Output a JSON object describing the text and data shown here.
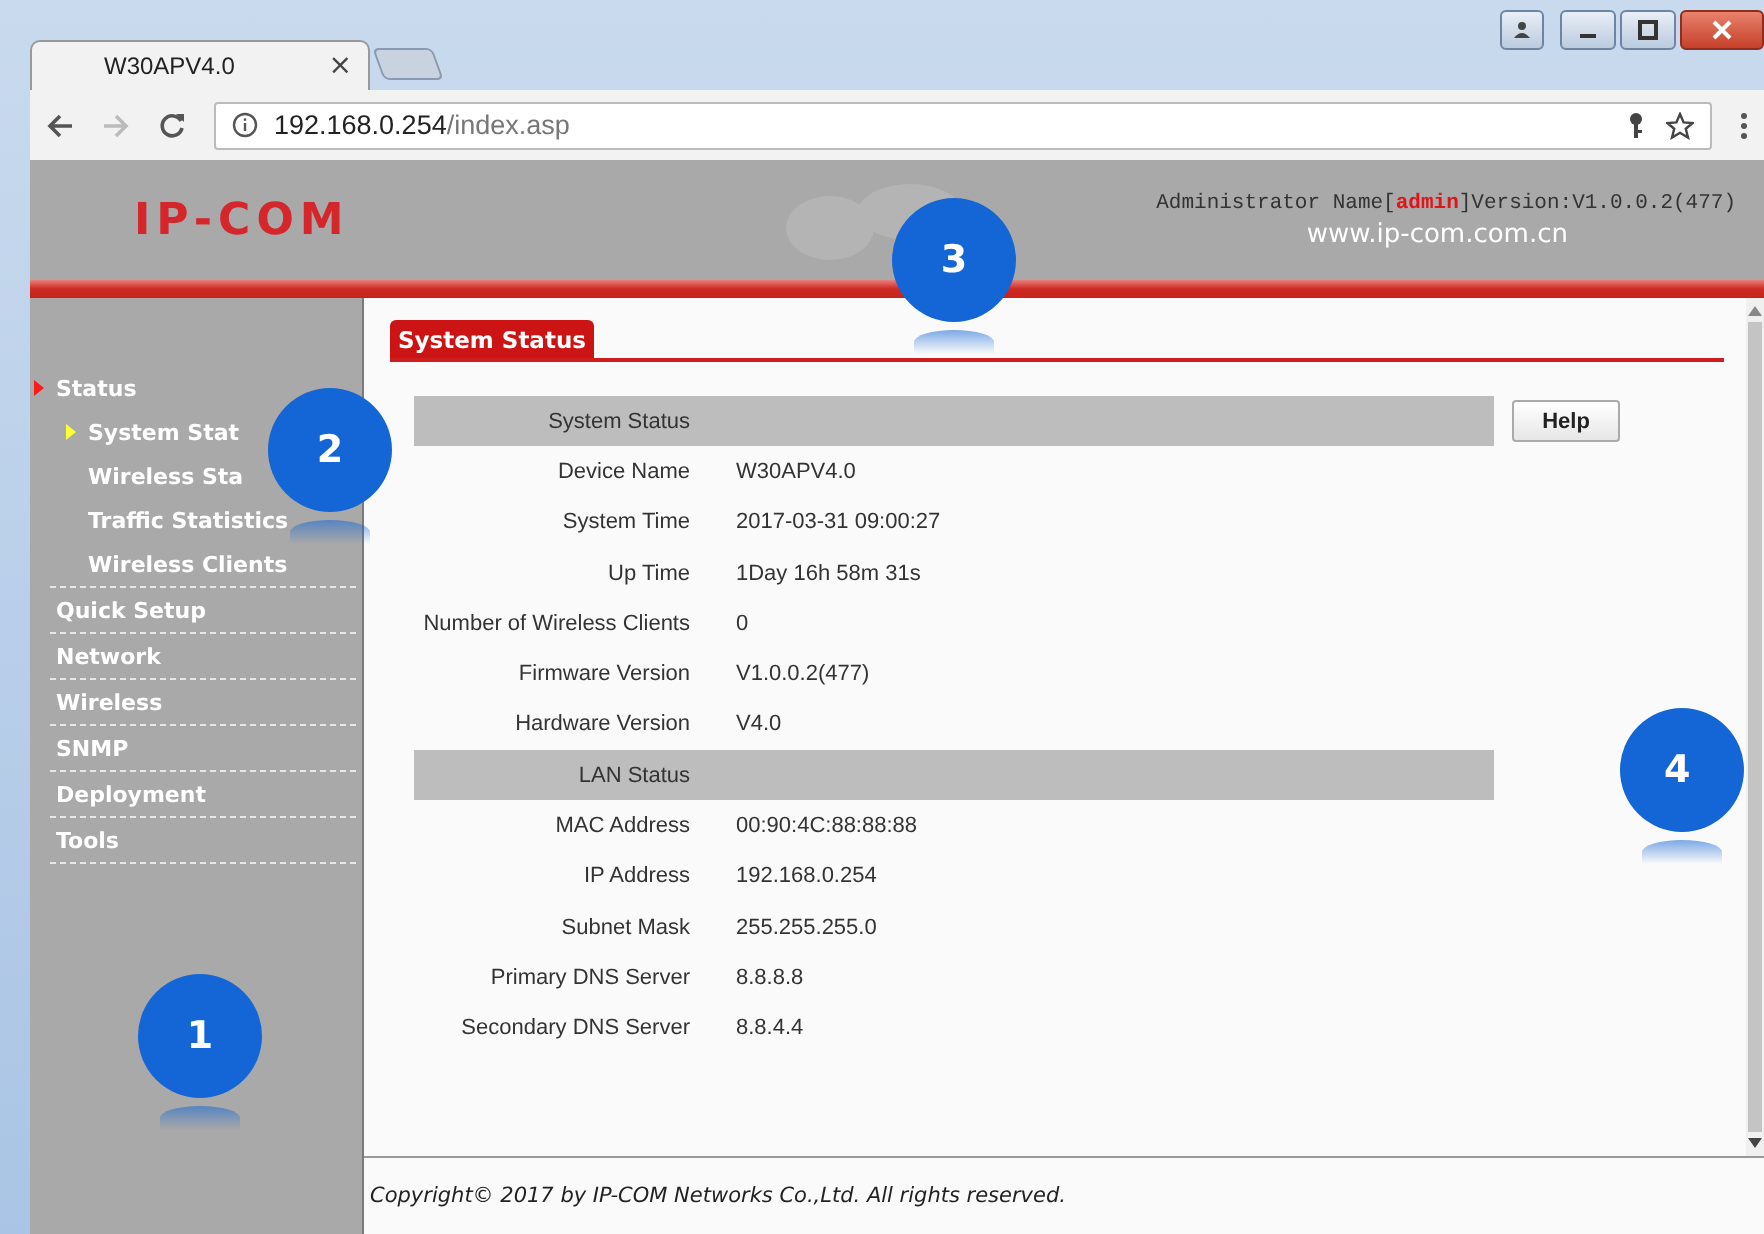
{
  "browser": {
    "tabs": [
      {
        "title": "W30APV4.0",
        "close": "×",
        "selected": true
      }
    ],
    "url_host": "192.168.0.254",
    "url_path": "/index.asp"
  },
  "header": {
    "logo": "IP-COM",
    "admin_label": "Administrator Name[",
    "admin_name": "admin",
    "version": "]Version:V1.0.0.2(477)",
    "website": "www.ip-com.com.cn"
  },
  "sidebar": {
    "items": [
      {
        "label": "Status",
        "expanded": true,
        "children": [
          {
            "label": "System Stat",
            "selected": true
          },
          {
            "label": "Wireless Sta",
            "selected": false
          },
          {
            "label": "Traffic Statistics",
            "selected": false
          },
          {
            "label": "Wireless Clients",
            "selected": false
          }
        ]
      },
      {
        "label": "Quick Setup",
        "expanded": false
      },
      {
        "label": "Network",
        "expanded": false
      },
      {
        "label": "Wireless",
        "expanded": false
      },
      {
        "label": "SNMP",
        "expanded": false
      },
      {
        "label": "Deployment",
        "expanded": false
      },
      {
        "label": "Tools",
        "expanded": false
      }
    ]
  },
  "content": {
    "tab": "System Status",
    "help_button": "Help",
    "rows": [
      {
        "kind": "header",
        "label": "System Status"
      },
      {
        "kind": "field",
        "label": "Device Name",
        "value": "W30APV4.0"
      },
      {
        "kind": "field",
        "label": "System Time",
        "value": "2017-03-31 09:00:27"
      },
      {
        "kind": "field",
        "label": "Up Time",
        "value": "1Day 16h 58m 31s"
      },
      {
        "kind": "field",
        "label": "Number of Wireless Clients",
        "value": "0"
      },
      {
        "kind": "field",
        "label": "Firmware Version",
        "value": "V1.0.0.2(477)"
      },
      {
        "kind": "field",
        "label": "Hardware Version",
        "value": "V4.0"
      },
      {
        "kind": "header",
        "label": "LAN Status"
      },
      {
        "kind": "field",
        "label": "MAC Address",
        "value": "00:90:4C:88:88:88"
      },
      {
        "kind": "field",
        "label": "IP Address",
        "value": "192.168.0.254"
      },
      {
        "kind": "field",
        "label": "Subnet Mask",
        "value": "255.255.255.0"
      },
      {
        "kind": "field",
        "label": "Primary DNS Server",
        "value": "8.8.8.8"
      },
      {
        "kind": "field",
        "label": "Secondary DNS Server",
        "value": "8.8.4.4"
      }
    ]
  },
  "footer": "Copyright© 2017 by IP-COM Networks Co.,Ltd. All rights reserved.",
  "callouts": [
    "1",
    "2",
    "3",
    "4"
  ]
}
